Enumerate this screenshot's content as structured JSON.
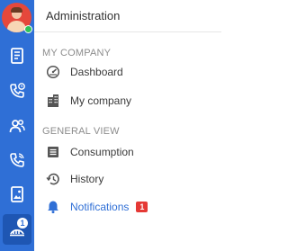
{
  "panel": {
    "title": "Administration"
  },
  "sections": [
    {
      "label": "MY COMPANY",
      "items": [
        {
          "label": "Dashboard",
          "icon": "dashboard-icon"
        },
        {
          "label": "My company",
          "icon": "building-icon"
        }
      ]
    },
    {
      "label": "GENERAL VIEW",
      "items": [
        {
          "label": "Consumption",
          "icon": "list-icon"
        },
        {
          "label": "History",
          "icon": "history-icon"
        },
        {
          "label": "Notifications",
          "icon": "bell-icon",
          "badge": "1",
          "active": true
        }
      ]
    }
  ],
  "rail": {
    "status": "online",
    "badge": "1",
    "items": [
      "document-icon",
      "clock-phone-icon",
      "users-icon",
      "phone-icon",
      "image-icon",
      "administration-icon"
    ]
  },
  "colors": {
    "rail": "#2f6fd6",
    "accent": "#2f6fd6",
    "badge": "#e53935",
    "status_online": "#2fc25b"
  }
}
